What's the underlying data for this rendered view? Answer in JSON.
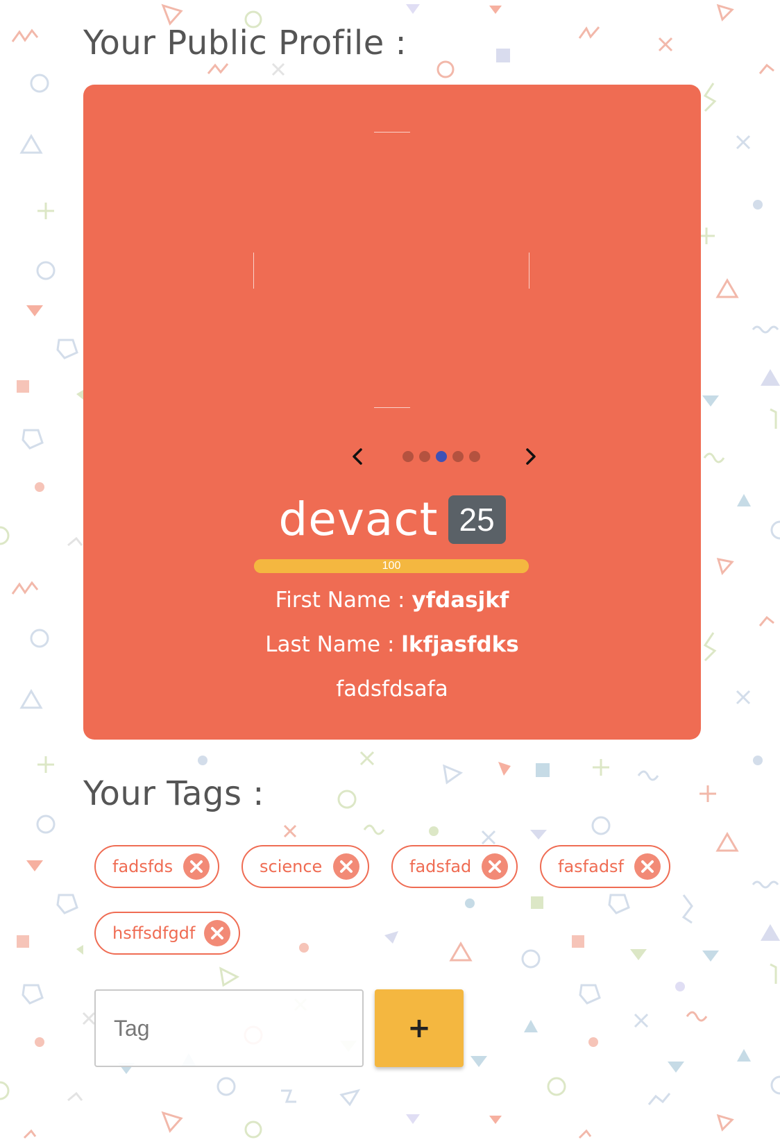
{
  "profile_section": {
    "heading": "Your Public Profile :",
    "carousel": {
      "dot_count": 5,
      "active_index": 2
    },
    "username": "devact",
    "age": "25",
    "popularity": {
      "value": 100,
      "max": 100,
      "label": "100"
    },
    "first_name_label": "First Name : ",
    "first_name": "yfdasjkf",
    "last_name_label": "Last Name : ",
    "last_name": "lkfjasfdks",
    "bio": "fadsfdsafa"
  },
  "tags_section": {
    "heading": "Your Tags :",
    "tags": [
      "fadsfds",
      "science",
      "fadsfad",
      "fasfadsf",
      "hsffsdfgdf"
    ],
    "input_placeholder": "Tag",
    "add_label": "+"
  },
  "colors": {
    "card": "#ef6c53",
    "accent": "#f4b740",
    "badge": "#5a6167",
    "active_dot": "#3f51b5"
  }
}
